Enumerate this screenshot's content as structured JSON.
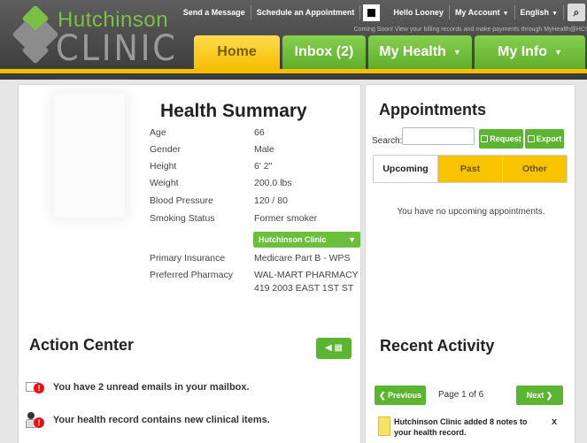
{
  "brand": {
    "name_top": "Hutchinson",
    "name_bottom": "CLINIC"
  },
  "top_links": {
    "send_message": "Send a Message",
    "schedule": "Schedule an Appointment",
    "greeting": "Hello Looney",
    "my_account": "My Account",
    "language": "English",
    "search_icon": "magnifier-icon"
  },
  "announcement": "Coming Soon! View your billing records and make payments through MyHealth@HC!",
  "nav": {
    "home": "Home",
    "inbox": "Inbox (2)",
    "my_health": "My Health",
    "my_info": "My Info"
  },
  "health_summary": {
    "title": "Health Summary",
    "rows": [
      {
        "label": "Age",
        "value": "66"
      },
      {
        "label": "Gender",
        "value": "Male"
      },
      {
        "label": "Height",
        "value": "6' 2\""
      },
      {
        "label": "Weight",
        "value": "200.0 lbs"
      },
      {
        "label": "Blood Pressure",
        "value": "120 / 80"
      },
      {
        "label": "Smoking Status",
        "value": "Former smoker"
      }
    ],
    "clinic_select": "Hutchinson Clinic",
    "primary_insurance_label": "Primary Insurance",
    "primary_insurance": "Medicare Part B - WPS",
    "pharmacy_label": "Preferred Pharmacy",
    "pharmacy_line1": "WAL-MART PHARMACY",
    "pharmacy_line2": "419 2003 EAST 1ST ST"
  },
  "action_center": {
    "title": "Action Center",
    "items": [
      "You have 2 unread emails in your mailbox.",
      "Your health record contains new clinical items."
    ]
  },
  "appointments": {
    "title": "Appointments",
    "search_label": "Search:",
    "search_value": "",
    "request_label": "Request",
    "export_label": "Export",
    "tabs": [
      "Upcoming",
      "Past",
      "Other"
    ],
    "empty_message": "You have no upcoming appointments."
  },
  "recent_activity": {
    "title": "Recent Activity",
    "prev_label": "Previous",
    "next_label": "Next",
    "page_info": "Page 1 of 6",
    "item": "Hutchinson Clinic added 8 notes to your health record.",
    "close": "x"
  }
}
